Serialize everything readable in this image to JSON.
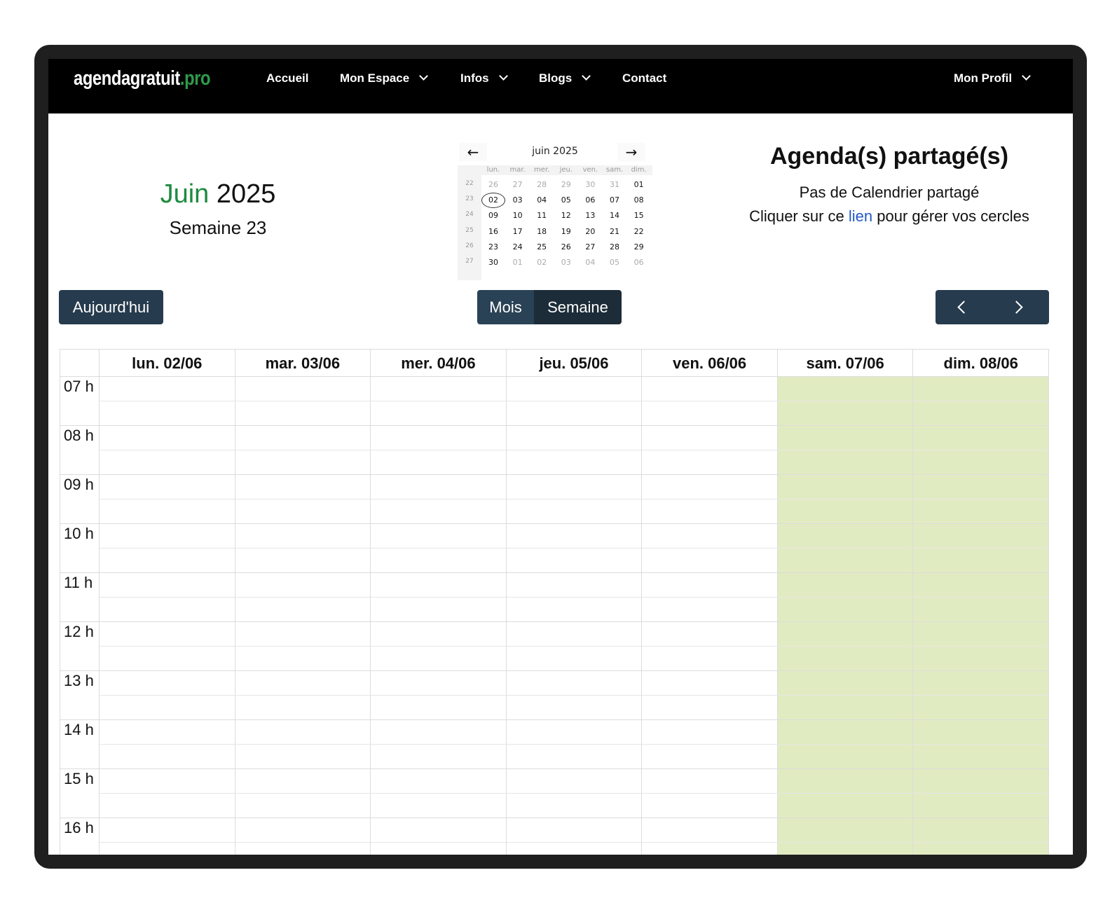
{
  "navbar": {
    "logo_main": "agendagratuit",
    "logo_accent": ".pro",
    "items": [
      {
        "label": "Accueil",
        "dropdown": false
      },
      {
        "label": "Mon Espace",
        "dropdown": true
      },
      {
        "label": "Infos",
        "dropdown": true
      },
      {
        "label": "Blogs",
        "dropdown": true
      },
      {
        "label": "Contact",
        "dropdown": false
      }
    ],
    "profile_label": "Mon Profil"
  },
  "header": {
    "month": "Juin",
    "year": "2025",
    "week": "Semaine 23"
  },
  "mini_calendar": {
    "title": "juin 2025",
    "prev_icon": "arrow-left-icon",
    "next_icon": "arrow-right-icon",
    "days_of_week": [
      "lun.",
      "mar.",
      "mer.",
      "jeu.",
      "ven.",
      "sam.",
      "dim."
    ],
    "weeks": [
      {
        "num": "22",
        "days": [
          "26",
          "27",
          "28",
          "29",
          "30",
          "31",
          "01"
        ],
        "other": [
          true,
          true,
          true,
          true,
          true,
          true,
          false
        ]
      },
      {
        "num": "23",
        "days": [
          "02",
          "03",
          "04",
          "05",
          "06",
          "07",
          "08"
        ],
        "other": [
          false,
          false,
          false,
          false,
          false,
          false,
          false
        ]
      },
      {
        "num": "24",
        "days": [
          "09",
          "10",
          "11",
          "12",
          "13",
          "14",
          "15"
        ],
        "other": [
          false,
          false,
          false,
          false,
          false,
          false,
          false
        ]
      },
      {
        "num": "25",
        "days": [
          "16",
          "17",
          "18",
          "19",
          "20",
          "21",
          "22"
        ],
        "other": [
          false,
          false,
          false,
          false,
          false,
          false,
          false
        ]
      },
      {
        "num": "26",
        "days": [
          "23",
          "24",
          "25",
          "26",
          "27",
          "28",
          "29"
        ],
        "other": [
          false,
          false,
          false,
          false,
          false,
          false,
          false
        ]
      },
      {
        "num": "27",
        "days": [
          "30",
          "01",
          "02",
          "03",
          "04",
          "05",
          "06"
        ],
        "other": [
          false,
          true,
          true,
          true,
          true,
          true,
          true
        ]
      }
    ],
    "selected": "02"
  },
  "shared": {
    "title": "Agenda(s) partagé(s)",
    "line1": "Pas de Calendrier partagé",
    "line2_before": "Cliquer sur ce ",
    "link_text": "lien",
    "line2_after": " pour gérer vos cercles"
  },
  "toolbar": {
    "today_label": "Aujourd'hui",
    "view_month": "Mois",
    "view_week": "Semaine",
    "active_view": "Semaine",
    "prev_icon": "chevron-left-icon",
    "next_icon": "chevron-right-icon"
  },
  "week_grid": {
    "columns": [
      "lun. 02/06",
      "mar. 03/06",
      "mer. 04/06",
      "jeu. 05/06",
      "ven. 06/06",
      "sam. 07/06",
      "dim. 08/06"
    ],
    "weekend_columns": [
      5,
      6
    ],
    "hours": [
      "07 h",
      "08 h",
      "09 h",
      "10 h",
      "11 h",
      "12 h",
      "13 h",
      "14 h",
      "15 h",
      "16 h"
    ]
  },
  "colors": {
    "brand_green": "#2f9a4b",
    "button_navy": "#263b4d",
    "weekend_fill": "#e1ebc1",
    "link_blue": "#2458c7"
  }
}
